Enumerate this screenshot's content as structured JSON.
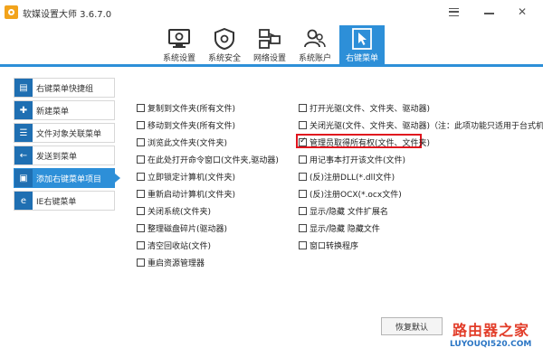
{
  "app": {
    "title": "软媒设置大师 3.6.7.0"
  },
  "nav": {
    "tabs": [
      {
        "label": "系统设置",
        "icon": "monitor-gear-icon"
      },
      {
        "label": "系统安全",
        "icon": "shield-gear-icon"
      },
      {
        "label": "网络设置",
        "icon": "network-icon"
      },
      {
        "label": "系统账户",
        "icon": "users-icon"
      },
      {
        "label": "右键菜单",
        "icon": "cursor-icon",
        "active": true
      }
    ]
  },
  "sidebar": {
    "items": [
      {
        "label": "右键菜单快捷组",
        "icon": "menu-group-icon"
      },
      {
        "label": "新建菜单",
        "icon": "new-menu-icon"
      },
      {
        "label": "文件对象关联菜单",
        "icon": "list-icon"
      },
      {
        "label": "发送到菜单",
        "icon": "send-to-icon"
      },
      {
        "label": "添加右键菜单项目",
        "icon": "add-menu-icon",
        "active": true
      },
      {
        "label": "IE右键菜单",
        "icon": "ie-icon"
      }
    ]
  },
  "options_left": [
    {
      "label": "复制到文件夹(所有文件)",
      "checked": false
    },
    {
      "label": "移动到文件夹(所有文件)",
      "checked": false
    },
    {
      "label": "浏览此文件夹(文件夹)",
      "checked": false
    },
    {
      "label": "在此处打开命令窗口(文件夹,驱动器)",
      "checked": false
    },
    {
      "label": "立即锁定计算机(文件夹)",
      "checked": false
    },
    {
      "label": "重新启动计算机(文件夹)",
      "checked": false
    },
    {
      "label": "关闭系统(文件夹)",
      "checked": false
    },
    {
      "label": "整理磁盘碎片(驱动器)",
      "checked": false
    },
    {
      "label": "清空回收站(文件)",
      "checked": false
    },
    {
      "label": "重启资源管理器",
      "checked": false
    }
  ],
  "options_right": [
    {
      "label": "打开光驱(文件、文件夹、驱动器)",
      "checked": false
    },
    {
      "label": "关闭光驱(文件、文件夹、驱动器)（注：此项功能只适用于台式机）",
      "checked": false
    },
    {
      "label": "管理员取得所有权(文件、文件夹)",
      "checked": true
    },
    {
      "label": "用记事本打开该文件(文件)",
      "checked": false
    },
    {
      "label": "(反)注册DLL(*.dll文件)",
      "checked": false
    },
    {
      "label": "(反)注册OCX(*.ocx文件)",
      "checked": false
    },
    {
      "label": "显示/隐藏 文件扩展名",
      "checked": false
    },
    {
      "label": "显示/隐藏 隐藏文件",
      "checked": false
    },
    {
      "label": "窗口转换程序",
      "checked": false
    }
  ],
  "buttons": {
    "restore_default": "恢复默认"
  },
  "watermark": {
    "text": "路由器之家",
    "url": "LUYOUQI520.COM"
  }
}
